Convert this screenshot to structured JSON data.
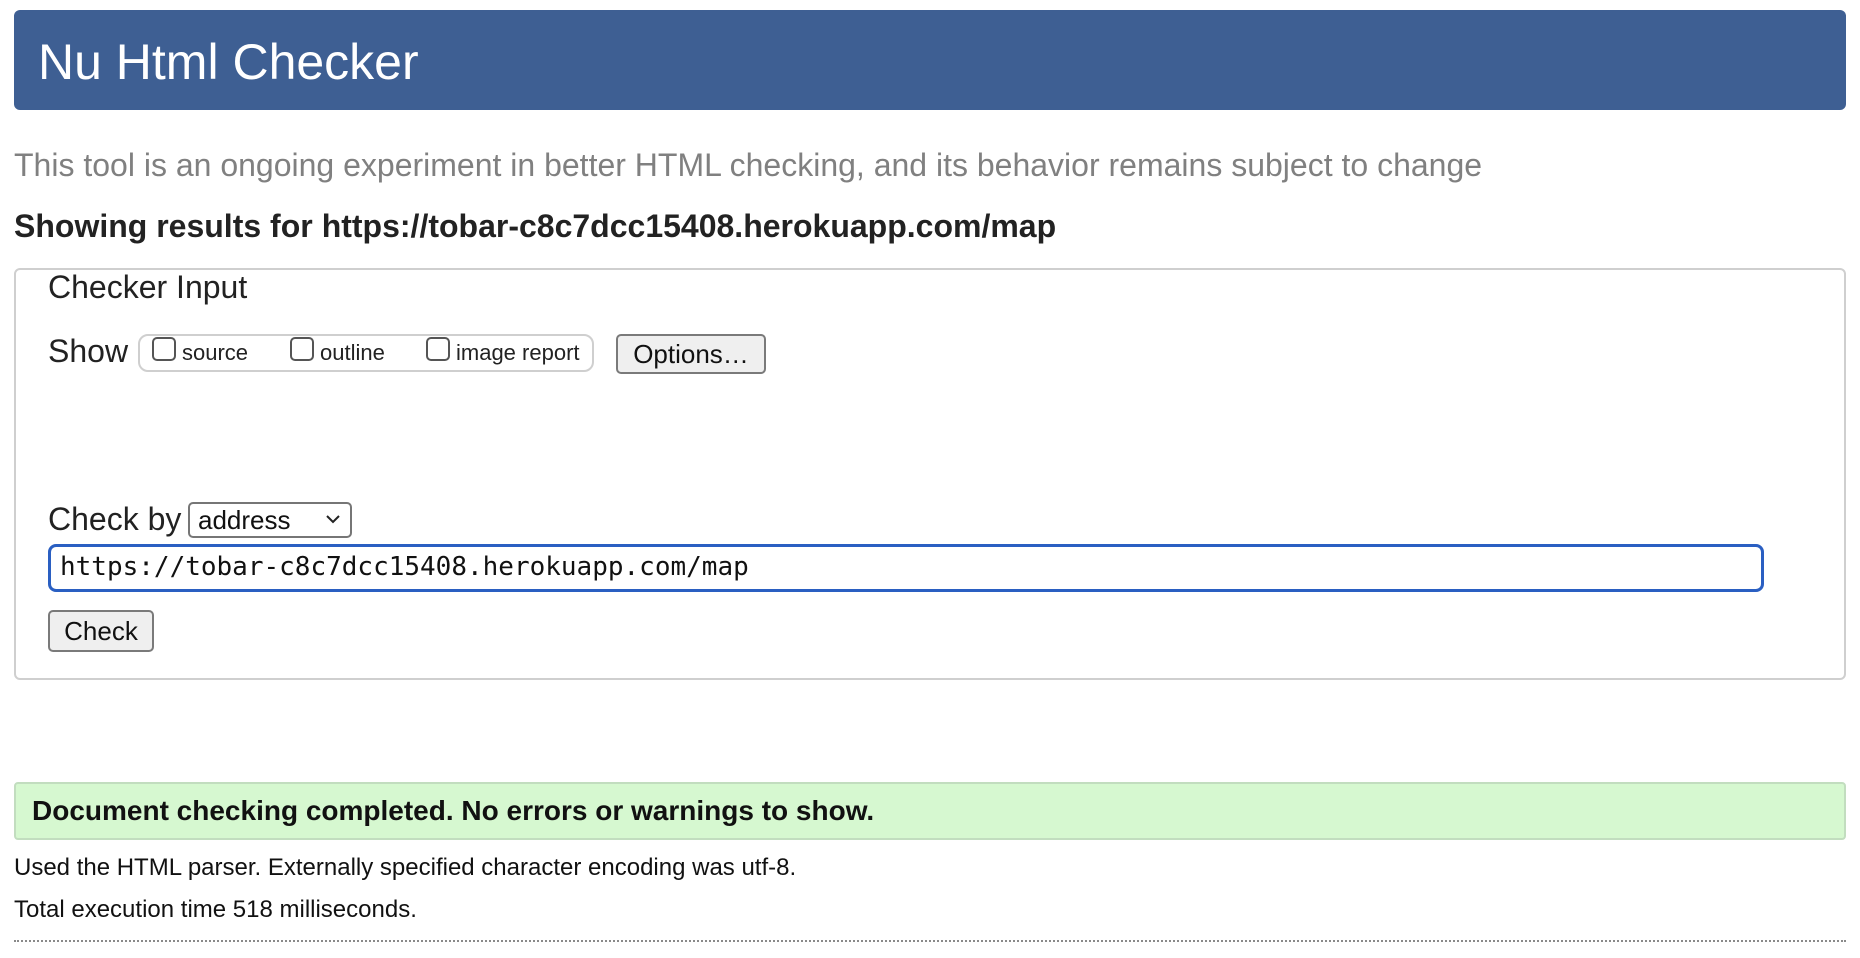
{
  "header": {
    "title": "Nu Html Checker"
  },
  "tagline": "This tool is an ongoing experiment in better HTML checking, and its behavior remains subject to change",
  "results_heading": {
    "prefix": "Showing results for",
    "url": "https://tobar-c8c7dcc15408.herokuapp.com/map"
  },
  "checker_input": {
    "legend": "Checker Input",
    "show_label": "Show",
    "show_options": [
      {
        "label": "source",
        "checked": false
      },
      {
        "label": "outline",
        "checked": false
      },
      {
        "label": "image report",
        "checked": false
      }
    ],
    "options_button": "Options…",
    "check_by_label": "Check by",
    "check_by_selected": "address",
    "url_value": "https://tobar-c8c7dcc15408.herokuapp.com/map",
    "check_button": "Check"
  },
  "status": {
    "message": "Document checking completed. No errors or warnings to show.",
    "color": "#d6f8d0"
  },
  "info": {
    "parser": "Used the HTML parser. Externally specified character encoding was utf-8.",
    "execution_time": "Total execution time 518 milliseconds."
  },
  "colors": {
    "header_bg": "#3e5f93",
    "input_focus": "#2a5fc2"
  }
}
